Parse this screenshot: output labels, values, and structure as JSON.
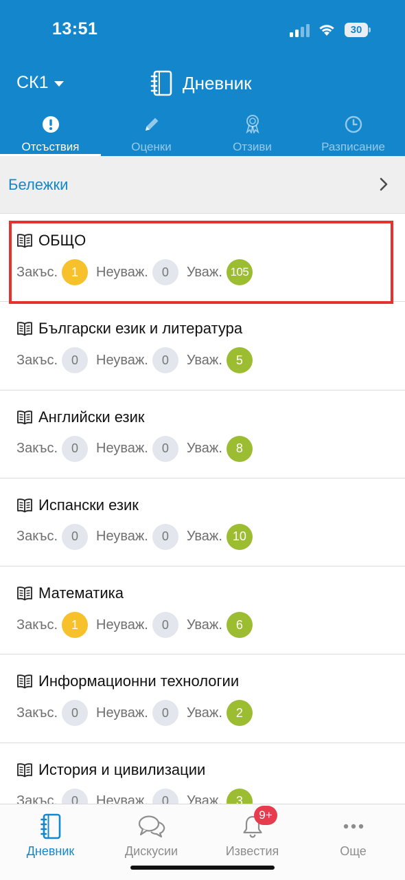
{
  "status_bar": {
    "time": "13:51",
    "battery": "30"
  },
  "header": {
    "class_selector": "СК1",
    "title": "Дневник"
  },
  "top_tabs": [
    {
      "label": "Отсъствия",
      "icon": "exclamation-circle-icon",
      "active": true
    },
    {
      "label": "Оценки",
      "icon": "pencil-icon",
      "active": false
    },
    {
      "label": "Отзиви",
      "icon": "award-ribbon-icon",
      "active": false
    },
    {
      "label": "Разписание",
      "icon": "clock-icon",
      "active": false
    }
  ],
  "notes": {
    "label": "Бележки"
  },
  "count_labels": {
    "excused_pending": "Закъс.",
    "unexcused": "Неуваж.",
    "excused": "Уваж."
  },
  "subjects": [
    {
      "name": "ОБЩО",
      "late": "1",
      "unexcused": "0",
      "excused": "105",
      "highlighted": true
    },
    {
      "name": "Български език и литература",
      "late": "0",
      "unexcused": "0",
      "excused": "5"
    },
    {
      "name": "Английски език",
      "late": "0",
      "unexcused": "0",
      "excused": "8"
    },
    {
      "name": "Испански език",
      "late": "0",
      "unexcused": "0",
      "excused": "10"
    },
    {
      "name": "Математика",
      "late": "1",
      "unexcused": "0",
      "excused": "6"
    },
    {
      "name": "Информационни технологии",
      "late": "0",
      "unexcused": "0",
      "excused": "2"
    },
    {
      "name": "История и цивилизации",
      "late": "0",
      "unexcused": "0",
      "excused": "3"
    }
  ],
  "bottom_nav": [
    {
      "label": "Дневник",
      "icon": "notebook-icon",
      "active": true
    },
    {
      "label": "Дискусии",
      "icon": "chat-bubbles-icon",
      "active": false
    },
    {
      "label": "Известия",
      "icon": "bell-icon",
      "active": false,
      "badge": "9+"
    },
    {
      "label": "Още",
      "icon": "more-dots-icon",
      "active": false
    }
  ],
  "colors": {
    "primary": "#1487cc",
    "late_badge": "#f6c12a",
    "excused_badge": "#9cbd32",
    "zero_badge": "#e3e6ec",
    "highlight": "#e5322d",
    "notification": "#e53c4e"
  }
}
